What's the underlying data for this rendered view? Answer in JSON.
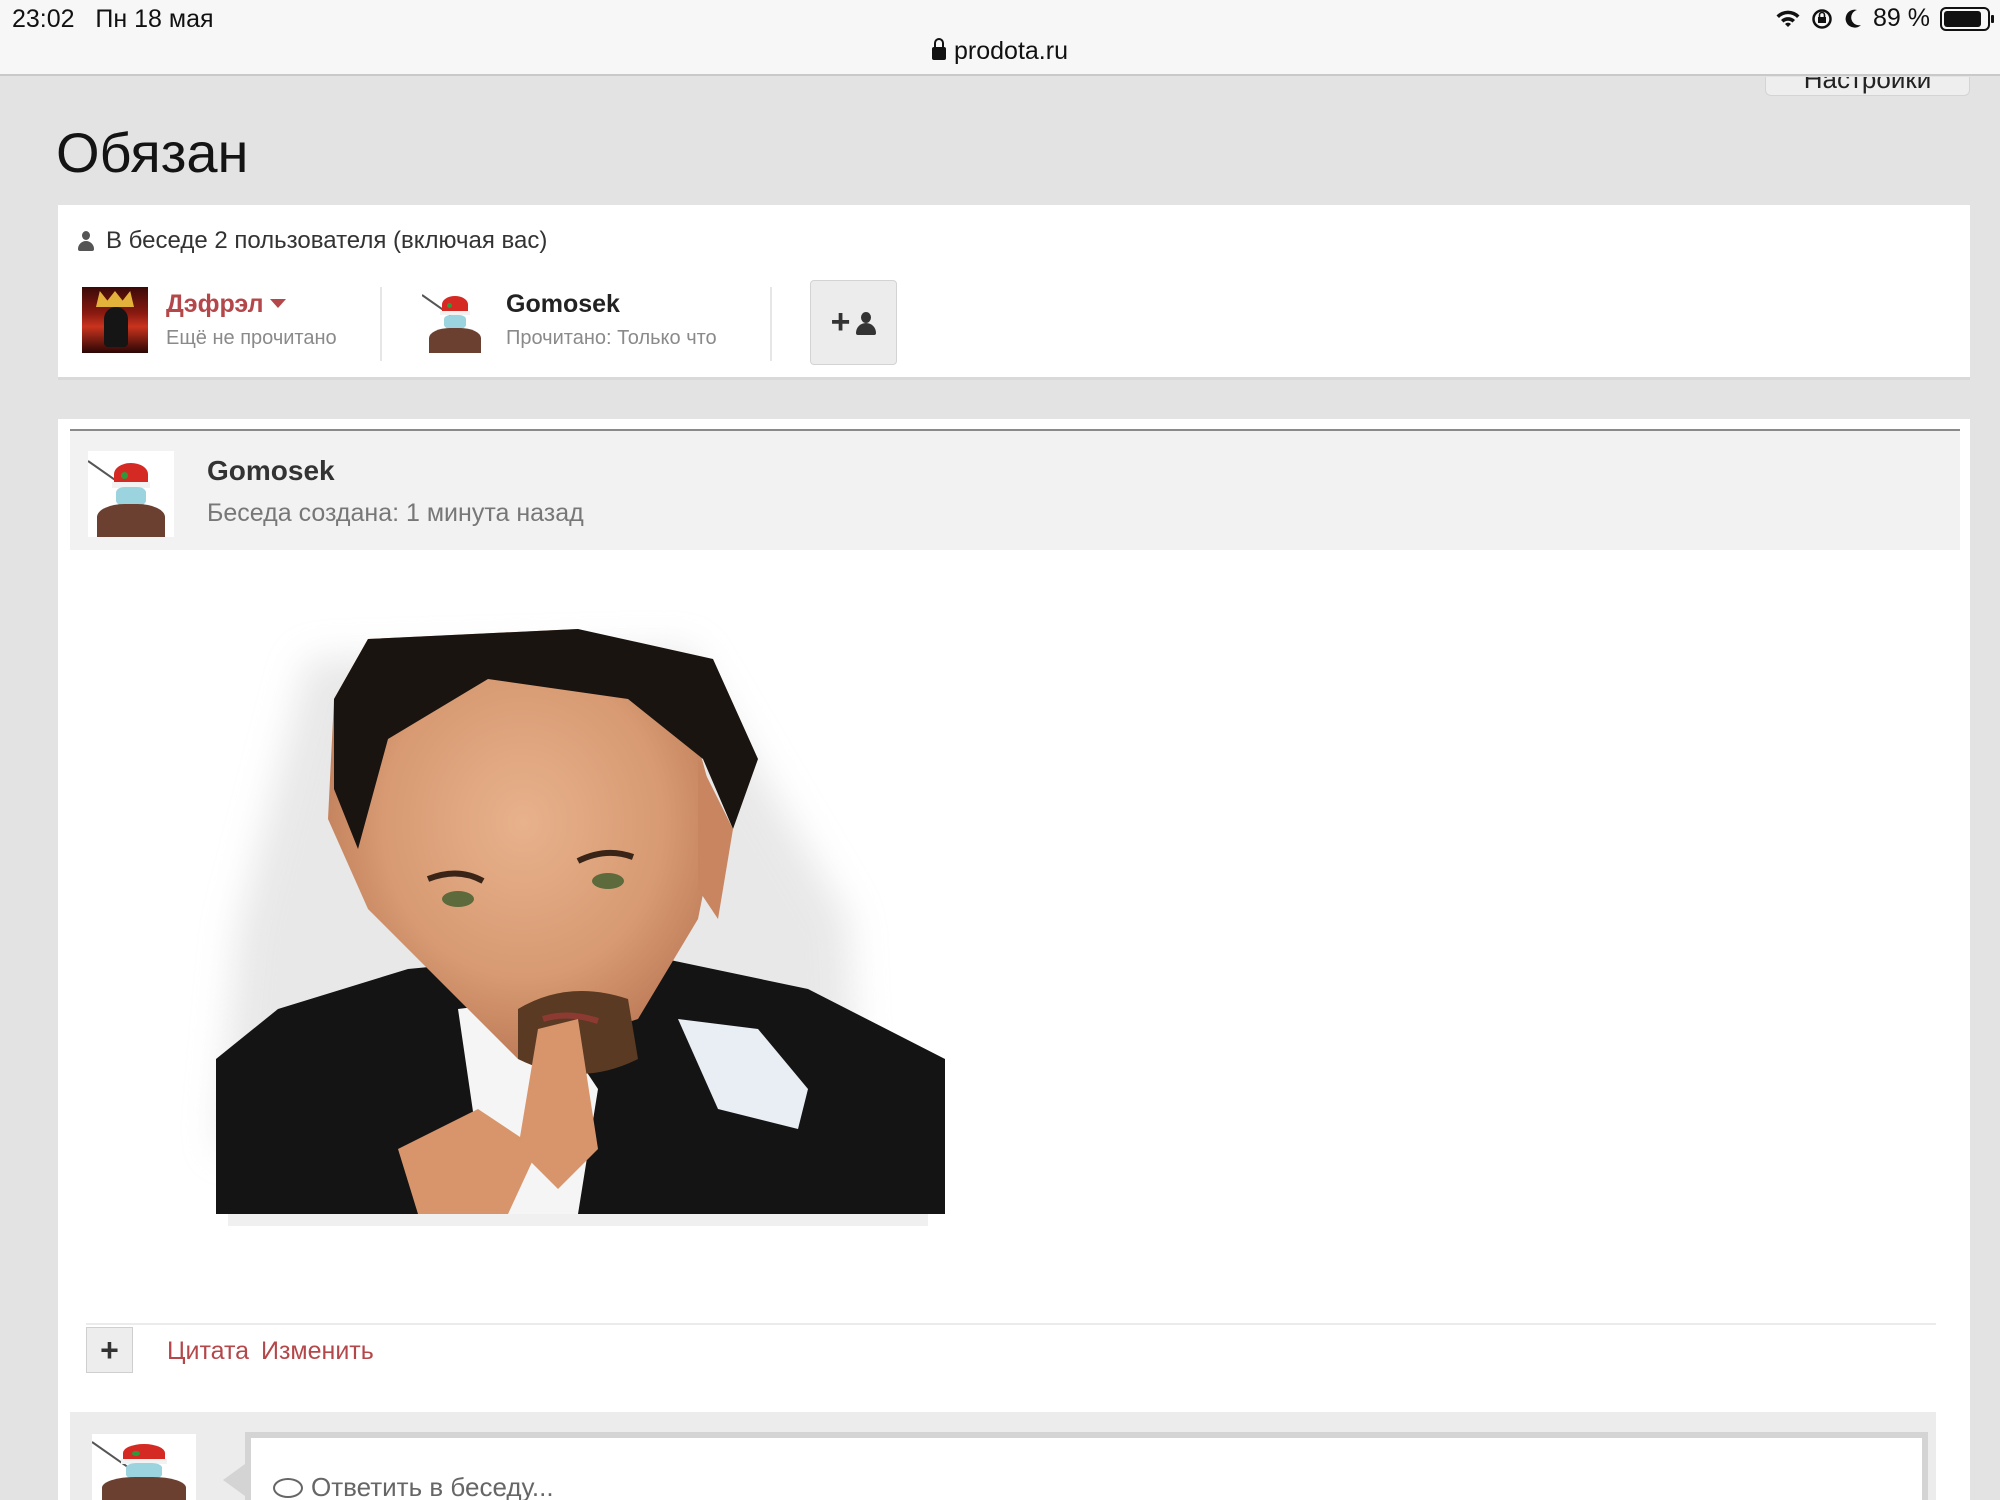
{
  "status_bar": {
    "time": "23:02",
    "date": "Пн 18 мая",
    "battery": "89 %",
    "battery_level": 0.89,
    "icons": [
      "wifi-icon",
      "orientation-lock-icon",
      "moon-icon",
      "battery-icon"
    ]
  },
  "browser": {
    "url": "prodota.ru"
  },
  "header": {
    "settings_label": "Настройки"
  },
  "page": {
    "title": "Обязан"
  },
  "participants": {
    "heading": "В беседе 2 пользователя (включая вас)",
    "members": [
      {
        "name": "Дэфрэл",
        "status": "Ещё не прочитано",
        "name_color": "#b4474a"
      },
      {
        "name": "Gomosek",
        "status": "Прочитано: Только что",
        "name_color": "#333333"
      }
    ]
  },
  "message": {
    "author": "Gomosek",
    "meta": "Беседа создана: 1 минута назад",
    "actions": {
      "quote": "Цитата",
      "edit": "Изменить"
    }
  },
  "reply": {
    "placeholder": "Ответить в беседу..."
  },
  "colors": {
    "accent": "#b4474a",
    "background": "#e3e3e3"
  }
}
